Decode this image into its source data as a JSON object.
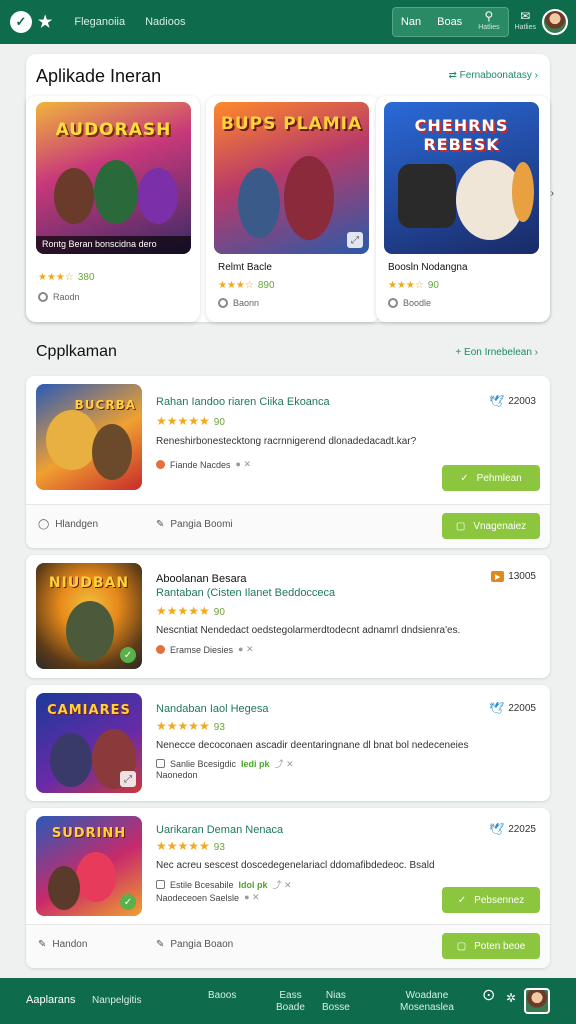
{
  "topbar": {
    "logo_glyph": "✓",
    "logo2_glyph": "★",
    "nav": [
      "Fleganoiia",
      "Nadioos"
    ],
    "group_items": [
      "Nan",
      "Boas"
    ],
    "icon1_label": "Hatlies",
    "icon2_label": "Hatlies"
  },
  "featured": {
    "title": "Aplikade Ineran",
    "link": "Fernaboonatasy",
    "cards": [
      {
        "art_title": "AUDORASH",
        "name": "Rontg Beran bonscidna dero",
        "rating": "★★★☆",
        "rating_num": "380",
        "meta": "Raodn",
        "colors": [
          "#f0b43a",
          "#7b2fa8",
          "#3a2a66"
        ]
      },
      {
        "art_title": "BUPS PLAMIA",
        "name": "Relmt Bacle",
        "rating": "★★★☆",
        "rating_num": "890",
        "meta": "Baonn",
        "colors": [
          "#ff8a2a",
          "#b83a6a",
          "#2a5aa8"
        ]
      },
      {
        "art_title": "CHEHRNS REBESK",
        "name": "Boosln Nodangna",
        "rating": "★★★☆",
        "rating_num": "90",
        "meta": "Boodle",
        "colors": [
          "#2a6ad8",
          "#e8c040",
          "#1a2a66"
        ]
      }
    ]
  },
  "apps_section": {
    "title": "Cpplkaman",
    "link": "Eon Irnebelean"
  },
  "apps": [
    {
      "title": "",
      "name": "Rahan Iandoo riaren Ciika Ekoanca",
      "stars": "★★★★★",
      "rating": "90",
      "desc": "Reneshirbonestecktong racrnnigerend dlonadedacadt.kar?",
      "meta": "Fiande Nacdes",
      "badge": "22003",
      "button": "Pehmlean",
      "button_icon": "✓",
      "art_title": "BUCRBA",
      "colors": [
        "#2a5ab8",
        "#f0a030",
        "#c82a2a"
      ]
    },
    {
      "title": "Aboolanan Besara",
      "name": "Rantaban (Cisten Ilanet Beddocceca",
      "stars": "★★★★★",
      "rating": "90",
      "desc": "Nescntiat Nendedact oedstegolarmerdtodecnt adnamrl dndsienra'es.",
      "meta": "Eramse Diesies",
      "badge": "13005",
      "button": "",
      "button_icon": "",
      "art_title": "NIUDBAN",
      "colors": [
        "#e88a1a",
        "#5a3a18",
        "#2a2a2a"
      ]
    },
    {
      "title": "",
      "name": "Nandaban Iaol Hegesa",
      "stars": "★★★★★",
      "rating": "93",
      "desc": "Nenecce decoconaen ascadir deentaringnane dl bnat bol nedeceneies",
      "meta": "Sanlie Bcesigdic",
      "meta_tag": "Iedi pk",
      "meta2": "Naonedon",
      "badge": "22005",
      "button": "",
      "button_icon": "",
      "art_title": "CAMIARES",
      "colors": [
        "#1a3a9a",
        "#f0c030",
        "#6a2aa8"
      ]
    },
    {
      "title": "",
      "name": "Uarikaran Deman Nenaca",
      "stars": "★★★★★",
      "rating": "93",
      "desc": "Nec acreu sescest doscedegenelariacl ddomafibdedeoc. Bsald",
      "meta": "Estile Bcesabile",
      "meta_tag": "Idol pk",
      "meta2": "Naodeceoen Saelsle",
      "badge": "22025",
      "button": "Pebsennez",
      "button_icon": "✓",
      "art_title": "SUDRINH",
      "colors": [
        "#c82a6a",
        "#f0a030",
        "#2a5ab8"
      ]
    }
  ],
  "card1_footer": {
    "left": "Hlandgen",
    "middle": "Pangia Boomi",
    "button": "Vnagenaiez",
    "button_icon": "▢"
  },
  "card4_footer": {
    "left": "Handon",
    "middle": "Pangia Boaon",
    "button": "Poten beoe",
    "button_icon": "▢"
  },
  "bottombar": {
    "brand": "Aaplarans",
    "nav1": "Nanpelgitis",
    "items": [
      {
        "a": "Baoos",
        "b": ""
      },
      {
        "a": "Eass",
        "b": "Boade"
      },
      {
        "a": "Nias",
        "b": "Bosse"
      },
      {
        "a": "Woadane",
        "b": "Mosenaslea"
      }
    ]
  }
}
